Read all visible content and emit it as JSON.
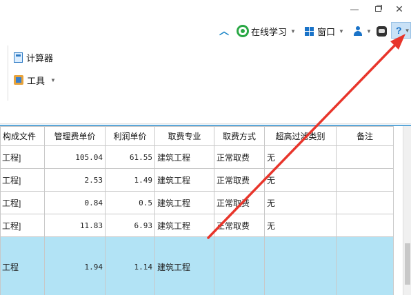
{
  "titlebar": {
    "minimize_label": "—",
    "close_label": "✕"
  },
  "topbar": {
    "collapse_icon": "chevron-up-icon",
    "online_learning_label": "在线学习",
    "window_label": "窗口",
    "help_label": "?"
  },
  "ribbon": {
    "calculator_label": "计算器",
    "tools_label": "工具"
  },
  "table": {
    "headers": [
      "构成文件",
      "管理费单价",
      "利润单价",
      "取费专业",
      "取费方式",
      "超高过滤类别",
      "备注"
    ],
    "rows": [
      [
        "工程]",
        "105.04",
        "61.55",
        "建筑工程",
        "正常取费",
        "无",
        ""
      ],
      [
        "工程]",
        "2.53",
        "1.49",
        "建筑工程",
        "正常取费",
        "无",
        ""
      ],
      [
        "工程]",
        "0.84",
        "0.5",
        "建筑工程",
        "正常取费",
        "无",
        ""
      ],
      [
        "工程]",
        "11.83",
        "6.93",
        "建筑工程",
        "正常取费",
        "无",
        ""
      ],
      [
        "工程",
        "1.94",
        "1.14",
        "建筑工程",
        "",
        "",
        ""
      ]
    ]
  },
  "colors": {
    "selected_row": "#b2e3f5",
    "arrow": "#e8352b",
    "accent": "#1a73c8"
  }
}
